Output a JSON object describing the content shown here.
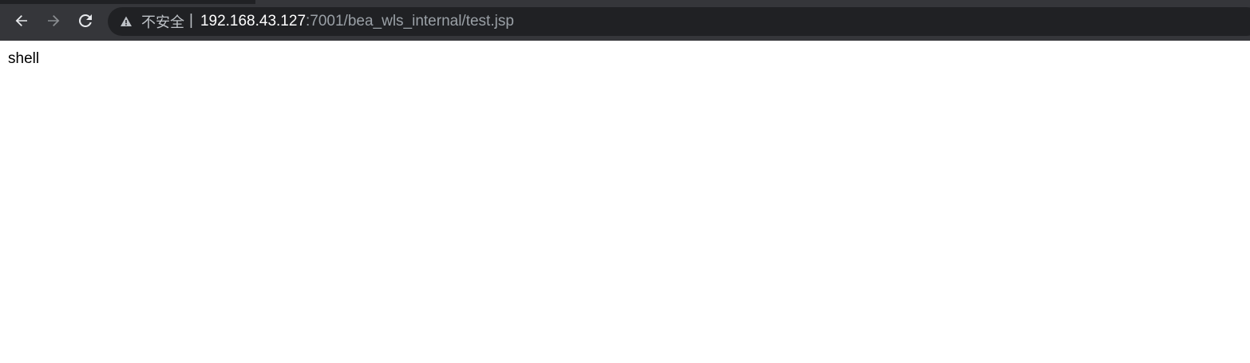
{
  "browser": {
    "nav": {
      "back_icon": "arrow-left-icon",
      "forward_icon": "arrow-right-icon",
      "reload_icon": "reload-icon"
    },
    "omnibox": {
      "security_icon": "warning-triangle-icon",
      "security_label": "不安全",
      "separator": "|",
      "url_host": "192.168.43.127",
      "url_rest": ":7001/bea_wls_internal/test.jsp"
    },
    "colors": {
      "toolbar_bg": "#35363a",
      "omnibox_bg": "#202124",
      "url_host_color": "#ffffff",
      "url_rest_color": "#9aa0a6"
    }
  },
  "page": {
    "body_text": "shell"
  }
}
